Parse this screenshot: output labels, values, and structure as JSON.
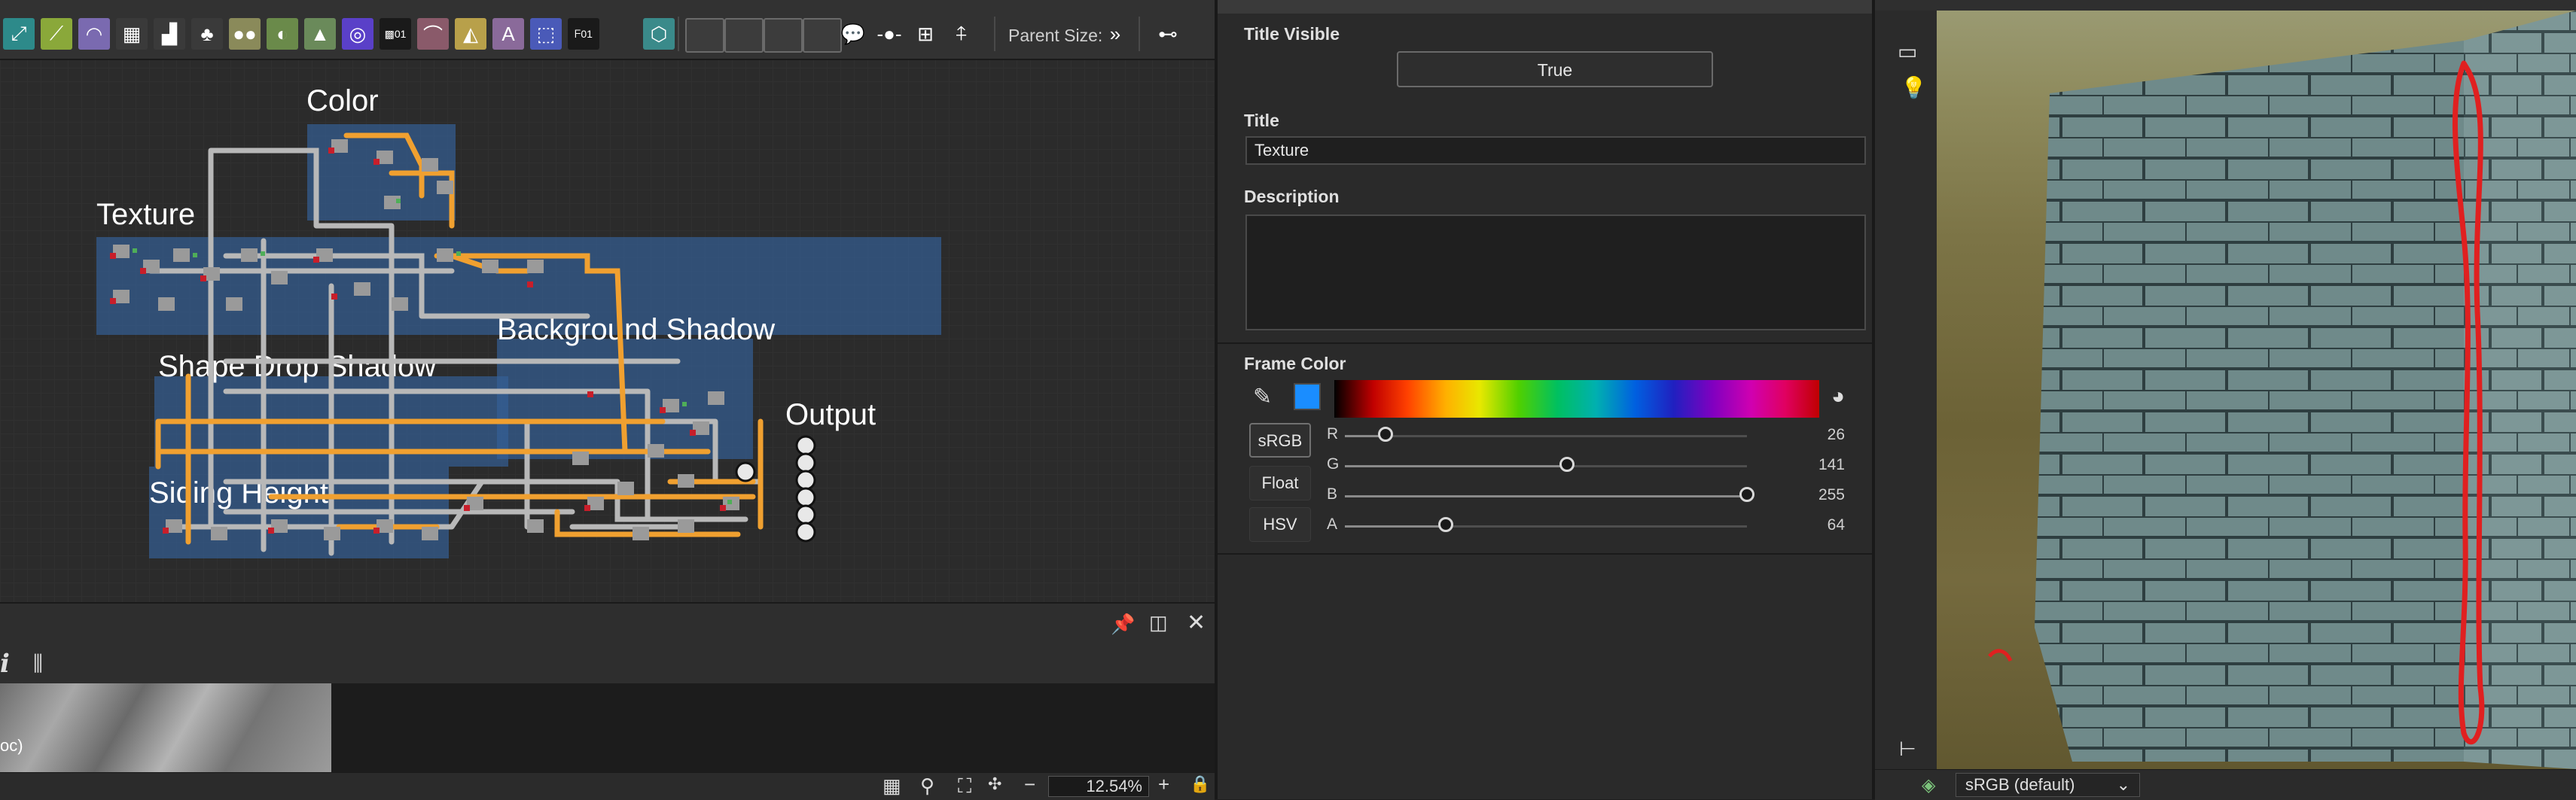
{
  "graph": {
    "toolbar": {
      "parent_size_label": "Parent Size:",
      "icons": [
        "transform-2d-icon",
        "gradient-map-icon",
        "blur-icon",
        "tile-generator-icon",
        "levels-icon",
        "hsl-icon",
        "uniform-color-icon",
        "blend-icon",
        "histogram-icon",
        "color-wheel-icon",
        "pixel-processor-icon",
        "warp-icon",
        "symmetry-icon",
        "text-icon",
        "crop-icon",
        "fx-map-icon",
        "shape-icon",
        "frame-icon",
        "comment-icon",
        "dot-icon",
        "pin-icon",
        "graph-align-icon"
      ]
    },
    "frames": [
      {
        "title": "Color"
      },
      {
        "title": "Texture"
      },
      {
        "title": "Background Shadow"
      },
      {
        "title": "Shape Drop Shadow"
      },
      {
        "title": "Siding Height"
      },
      {
        "title": "Output"
      }
    ]
  },
  "view2d": {
    "toolbar_glyph": "i",
    "thumb_caption": "oc)",
    "zoom": "12.54%"
  },
  "properties": {
    "title_visible_label": "Title Visible",
    "title_visible_value": "True",
    "title_label": "Title",
    "title_value": "Texture",
    "description_label": "Description",
    "description_value": "",
    "frame_color_label": "Frame Color",
    "swatch_color": "#1a8dff",
    "modes": [
      "sRGB",
      "Float",
      "HSV"
    ],
    "active_mode": "sRGB",
    "channels": [
      {
        "name": "R",
        "value": "26",
        "fraction": 0.102
      },
      {
        "name": "G",
        "value": "141",
        "fraction": 0.553
      },
      {
        "name": "B",
        "value": "255",
        "fraction": 1.0
      },
      {
        "name": "A",
        "value": "64",
        "fraction": 0.251
      }
    ]
  },
  "view3d": {
    "colorspace": "sRGB (default)"
  },
  "colors": {
    "frame_fill": "#346096",
    "wire_orange": "#f0a030",
    "wire_gray": "#b8b8b8",
    "annotation_red": "#e02020"
  }
}
